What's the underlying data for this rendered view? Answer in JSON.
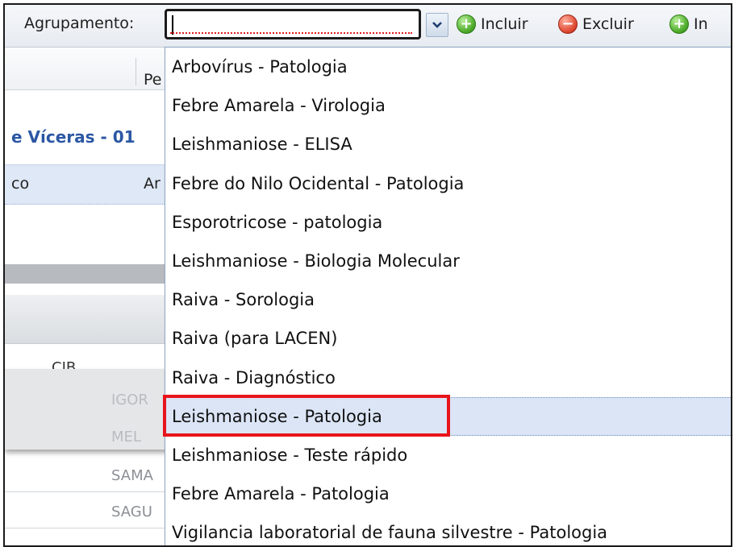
{
  "toolbar": {
    "label": "Agrupamento:",
    "combo_value": "",
    "buttons": [
      {
        "label": "Incluir",
        "icon": "plus-circle-green-icon"
      },
      {
        "label": "Excluir",
        "icon": "minus-circle-red-icon"
      },
      {
        "label": "In",
        "icon": "plus-circle-green-icon"
      }
    ]
  },
  "background": {
    "header_col": "Pe",
    "section_title": "e Víceras - 01",
    "row": {
      "c1": "co",
      "c2": "Ar"
    },
    "cib": "CIB",
    "names": [
      "IGOR",
      "MEL",
      "SAMA",
      "SAGU"
    ]
  },
  "dropdown": {
    "items": [
      "Arbovírus - Patologia",
      "Febre Amarela - Virologia",
      "Leishmaniose - ELISA",
      "Febre do Nilo Ocidental - Patologia",
      "Esporotricose - patologia",
      "Leishmaniose - Biologia Molecular",
      "Raiva - Sorologia",
      "Raiva (para LACEN)",
      "Raiva - Diagnóstico",
      "Leishmaniose - Patologia",
      "Leishmaniose - Teste rápido",
      "Febre Amarela - Patologia",
      "Vigilancia laboratorial de fauna silvestre - Patologia"
    ],
    "selected_index": 9
  },
  "colors": {
    "highlight": "#e8141c",
    "selected_bg": "#dbe5f6",
    "title_blue": "#2b57a3"
  }
}
